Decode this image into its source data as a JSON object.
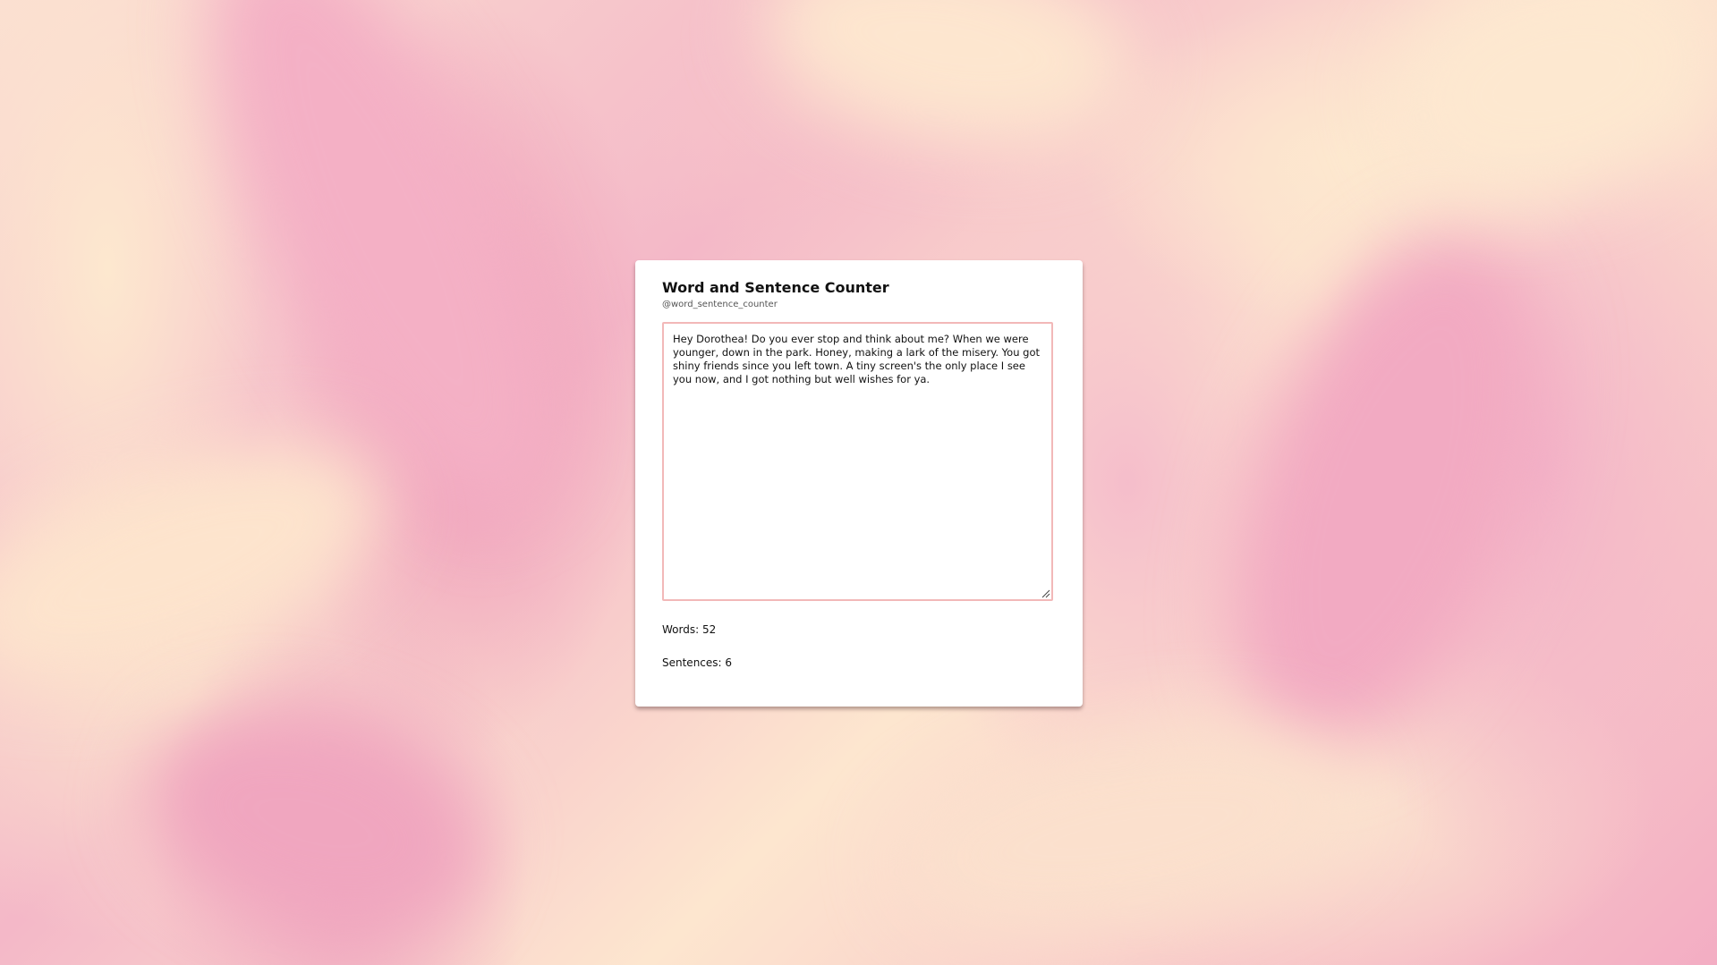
{
  "app": {
    "title": "Word and Sentence Counter",
    "handle": "@word_sentence_counter"
  },
  "editor": {
    "value": "Hey Dorothea! Do you ever stop and think about me? When we were younger, down in the park. Honey, making a lark of the misery. You got shiny friends since you left town. A tiny screen's the only place I see you now, and I got nothing but well wishes for ya.",
    "placeholder": ""
  },
  "stats": {
    "words_label": "Words: 52",
    "sentences_label": "Sentences: 6"
  },
  "colors": {
    "textarea_border": "#f2b8b8",
    "card_background": "#ffffff",
    "background_pink": "#f0a9c0",
    "background_cream": "#fde8cf"
  },
  "icons": {
    "resize_handle": "resize-grip-icon"
  }
}
